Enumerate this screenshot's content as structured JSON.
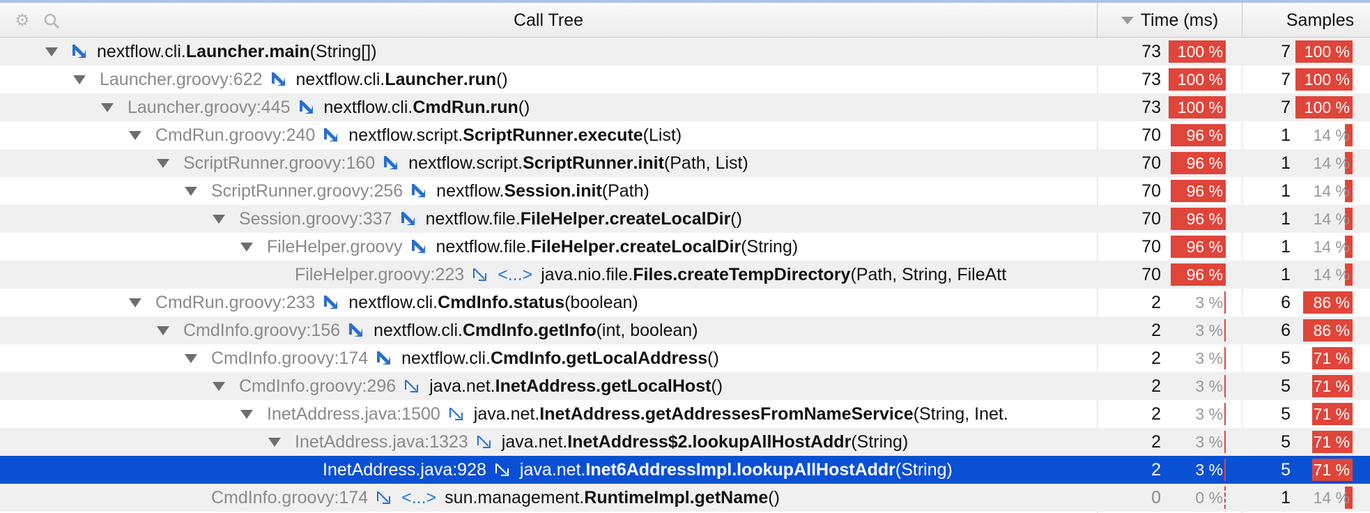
{
  "header": {
    "call_tree_title": "Call Tree",
    "time_title": "Time (ms)",
    "samples_title": "Samples",
    "settings_icon": "gear-icon",
    "search_icon": "search-icon",
    "sort_icon": "sort-descending-icon"
  },
  "colors": {
    "bar": "#e0453a",
    "selected": "#0a50d4",
    "stripe": "#f0f0f0",
    "arrow": "#2a6fd0"
  },
  "rows": [
    {
      "depth": 0,
      "expanded": true,
      "location": "",
      "arrow": "solid",
      "ellipsis": "",
      "pkg": "nextflow.cli.",
      "cls": "Launcher",
      "method": ".main",
      "args": "(String[])",
      "time": "73",
      "time_pct": 100,
      "time_label": "100 %",
      "samples": "7",
      "samples_pct": 100,
      "samples_label": "100 %"
    },
    {
      "depth": 1,
      "expanded": true,
      "location": "Launcher.groovy:622",
      "arrow": "solid",
      "ellipsis": "",
      "pkg": "nextflow.cli.",
      "cls": "Launcher",
      "method": ".run",
      "args": "()",
      "time": "73",
      "time_pct": 100,
      "time_label": "100 %",
      "samples": "7",
      "samples_pct": 100,
      "samples_label": "100 %"
    },
    {
      "depth": 2,
      "expanded": true,
      "location": "Launcher.groovy:445",
      "arrow": "solid",
      "ellipsis": "",
      "pkg": "nextflow.cli.",
      "cls": "CmdRun",
      "method": ".run",
      "args": "()",
      "time": "73",
      "time_pct": 100,
      "time_label": "100 %",
      "samples": "7",
      "samples_pct": 100,
      "samples_label": "100 %"
    },
    {
      "depth": 3,
      "expanded": true,
      "location": "CmdRun.groovy:240",
      "arrow": "solid",
      "ellipsis": "",
      "pkg": "nextflow.script.",
      "cls": "ScriptRunner",
      "method": ".execute",
      "args": "(List)",
      "time": "70",
      "time_pct": 96,
      "time_label": "96 %",
      "samples": "1",
      "samples_pct": 14,
      "samples_label": "14 %"
    },
    {
      "depth": 4,
      "expanded": true,
      "location": "ScriptRunner.groovy:160",
      "arrow": "solid",
      "ellipsis": "",
      "pkg": "nextflow.script.",
      "cls": "ScriptRunner",
      "method": ".init",
      "args": "(Path, List)",
      "time": "70",
      "time_pct": 96,
      "time_label": "96 %",
      "samples": "1",
      "samples_pct": 14,
      "samples_label": "14 %"
    },
    {
      "depth": 5,
      "expanded": true,
      "location": "ScriptRunner.groovy:256",
      "arrow": "solid",
      "ellipsis": "",
      "pkg": "nextflow.",
      "cls": "Session",
      "method": ".init",
      "args": "(Path)",
      "time": "70",
      "time_pct": 96,
      "time_label": "96 %",
      "samples": "1",
      "samples_pct": 14,
      "samples_label": "14 %"
    },
    {
      "depth": 6,
      "expanded": true,
      "location": "Session.groovy:337",
      "arrow": "solid",
      "ellipsis": "",
      "pkg": "nextflow.file.",
      "cls": "FileHelper",
      "method": ".createLocalDir",
      "args": "()",
      "time": "70",
      "time_pct": 96,
      "time_label": "96 %",
      "samples": "1",
      "samples_pct": 14,
      "samples_label": "14 %"
    },
    {
      "depth": 7,
      "expanded": true,
      "location": "FileHelper.groovy",
      "arrow": "solid",
      "ellipsis": "",
      "pkg": "nextflow.file.",
      "cls": "FileHelper",
      "method": ".createLocalDir",
      "args": "(String)",
      "time": "70",
      "time_pct": 96,
      "time_label": "96 %",
      "samples": "1",
      "samples_pct": 14,
      "samples_label": "14 %"
    },
    {
      "depth": 8,
      "expanded": false,
      "location": "FileHelper.groovy:223",
      "arrow": "outline",
      "ellipsis": "<...>",
      "pkg": "java.nio.file.",
      "cls": "Files",
      "method": ".createTempDirectory",
      "args": "(Path, String, FileAtt",
      "time": "70",
      "time_pct": 96,
      "time_label": "96 %",
      "samples": "1",
      "samples_pct": 14,
      "samples_label": "14 %"
    },
    {
      "depth": 3,
      "expanded": true,
      "location": "CmdRun.groovy:233",
      "arrow": "solid",
      "ellipsis": "",
      "pkg": "nextflow.cli.",
      "cls": "CmdInfo",
      "method": ".status",
      "args": "(boolean)",
      "time": "2",
      "time_pct": 3,
      "time_label": "3 %",
      "samples": "6",
      "samples_pct": 86,
      "samples_label": "86 %"
    },
    {
      "depth": 4,
      "expanded": true,
      "location": "CmdInfo.groovy:156",
      "arrow": "solid",
      "ellipsis": "",
      "pkg": "nextflow.cli.",
      "cls": "CmdInfo",
      "method": ".getInfo",
      "args": "(int, boolean)",
      "time": "2",
      "time_pct": 3,
      "time_label": "3 %",
      "samples": "6",
      "samples_pct": 86,
      "samples_label": "86 %"
    },
    {
      "depth": 5,
      "expanded": true,
      "location": "CmdInfo.groovy:174",
      "arrow": "solid",
      "ellipsis": "",
      "pkg": "nextflow.cli.",
      "cls": "CmdInfo",
      "method": ".getLocalAddress",
      "args": "()",
      "time": "2",
      "time_pct": 3,
      "time_label": "3 %",
      "samples": "5",
      "samples_pct": 71,
      "samples_label": "71 %"
    },
    {
      "depth": 6,
      "expanded": true,
      "location": "CmdInfo.groovy:296",
      "arrow": "outline",
      "ellipsis": "",
      "pkg": "java.net.",
      "cls": "InetAddress",
      "method": ".getLocalHost",
      "args": "()",
      "time": "2",
      "time_pct": 3,
      "time_label": "3 %",
      "samples": "5",
      "samples_pct": 71,
      "samples_label": "71 %"
    },
    {
      "depth": 7,
      "expanded": true,
      "location": "InetAddress.java:1500",
      "arrow": "outline",
      "ellipsis": "",
      "pkg": "java.net.",
      "cls": "InetAddress",
      "method": ".getAddressesFromNameService",
      "args": "(String, Inet.",
      "time": "2",
      "time_pct": 3,
      "time_label": "3 %",
      "samples": "5",
      "samples_pct": 71,
      "samples_label": "71 %"
    },
    {
      "depth": 8,
      "expanded": true,
      "location": "InetAddress.java:1323",
      "arrow": "outline",
      "ellipsis": "",
      "pkg": "java.net.",
      "cls": "InetAddress$2",
      "method": ".lookupAllHostAddr",
      "args": "(String)",
      "time": "2",
      "time_pct": 3,
      "time_label": "3 %",
      "samples": "5",
      "samples_pct": 71,
      "samples_label": "71 %"
    },
    {
      "depth": 9,
      "expanded": false,
      "selected": true,
      "location": "InetAddress.java:928",
      "arrow": "outline",
      "ellipsis": "",
      "pkg": "java.net.",
      "cls": "Inet6AddressImpl",
      "method": ".lookupAllHostAddr",
      "args": "(String)",
      "time": "2",
      "time_pct": 3,
      "time_label": "3 %",
      "samples": "5",
      "samples_pct": 71,
      "samples_label": "71 %"
    },
    {
      "depth": 5,
      "expanded": false,
      "location": "CmdInfo.groovy:174",
      "arrow": "outline",
      "ellipsis": "<...>",
      "pkg": "sun.management.",
      "cls": "RuntimeImpl",
      "method": ".getName",
      "args": "()",
      "time": "0",
      "time_pct": 0,
      "time_label": "0 %",
      "samples": "1",
      "samples_pct": 14,
      "samples_label": "14 %"
    }
  ]
}
